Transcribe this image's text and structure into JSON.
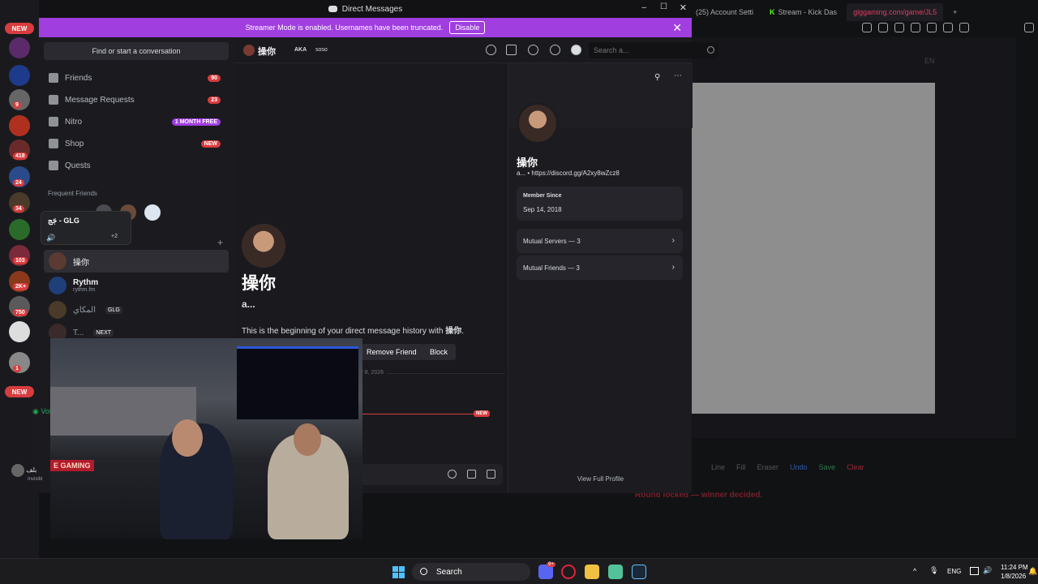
{
  "browser": {
    "tabs": [
      {
        "label": "(25) Account Setti",
        "active": false
      },
      {
        "label": "Stream - Kick Das",
        "active": false
      },
      {
        "label": "glggaming.com/game/JL5",
        "active": true
      }
    ],
    "site": {
      "lang": "EN",
      "tools": [
        "Line",
        "Fill",
        "Eraser",
        "Undo",
        "Save",
        "Clear"
      ],
      "status": "Round locked — winner decided."
    }
  },
  "rail": {
    "new_top": "NEW",
    "new_bottom": "NEW",
    "badges": [
      "9",
      "418",
      "24",
      "34",
      "103",
      "2K+",
      "750",
      "1"
    ]
  },
  "discord": {
    "title": "Direct Messages",
    "banner": {
      "text": "Streamer Mode is enabled. Usernames have been truncated.",
      "disable": "Disable"
    },
    "sidebar": {
      "find": "Find or start a conversation",
      "nav": [
        {
          "label": "Friends",
          "badge": "90"
        },
        {
          "label": "Message Requests",
          "badge": "23"
        },
        {
          "label": "Nitro",
          "badge": "1 MONTH FREE"
        },
        {
          "label": "Shop",
          "badge": "NEW"
        },
        {
          "label": "Quests",
          "badge": ""
        }
      ],
      "frequent_label": "Frequent Friends",
      "voice_popup": {
        "title": "جَج - GLG",
        "extra": "+2"
      },
      "dms": [
        {
          "name": "操你",
          "sub": "",
          "tag": ""
        },
        {
          "name": "Rythm",
          "sub": "rythm.fm",
          "tag": ""
        },
        {
          "name": "المكاي",
          "sub": "",
          "tag": "GLG"
        },
        {
          "name": "T...",
          "sub": "",
          "tag": "NEXT"
        }
      ],
      "voice_label": "Voice",
      "user_label": "بلف",
      "user_status": "Invisibl"
    },
    "header": {
      "name": "操你",
      "aka": "AKA",
      "alias": "soso",
      "search_placeholder": "Search a..."
    },
    "chat": {
      "name": "操你",
      "username": "a...",
      "history_prefix": "This is the beginning of your direct message history with ",
      "history_name": "操你",
      "remove_friend": "Remove Friend",
      "block": "Block",
      "date": "ry 8, 2026",
      "new_tag": "NEW"
    },
    "profile": {
      "name": "操你",
      "sub": "a... • https://discord.gg/A2xy8wZcz8",
      "member_since_label": "Member Since",
      "member_since": "Sep 14, 2018",
      "mutual_servers": "Mutual Servers — 3",
      "mutual_friends": "Mutual Friends — 3",
      "view_full": "View Full Profile"
    }
  },
  "webcam": {
    "sign": "E GAMING"
  },
  "taskbar": {
    "search": "Search",
    "lang": "ENG",
    "time": "11:24 PM",
    "date": "1/8/2026",
    "discord_badge": "9+"
  }
}
